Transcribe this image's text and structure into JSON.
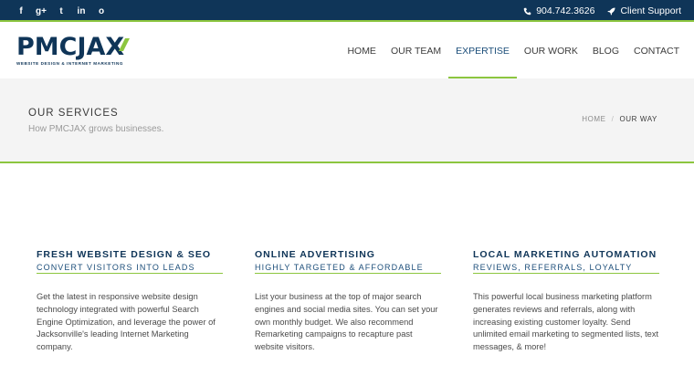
{
  "social": {
    "icons": [
      "facebook-icon",
      "google-plus-icon",
      "twitter-icon",
      "linkedin-icon",
      "instagram-icon"
    ],
    "glyphs": [
      "f",
      "g+",
      "t",
      "in",
      "o"
    ]
  },
  "topbar": {
    "phone": "904.742.3626",
    "support": "Client Support"
  },
  "logo": {
    "wordmark": "PMCJAX",
    "tagline": "WEBSITE DESIGN & INTERNET MARKETING"
  },
  "nav": {
    "items": [
      "HOME",
      "OUR TEAM",
      "EXPERTISE",
      "OUR WORK",
      "BLOG",
      "CONTACT"
    ],
    "active": "EXPERTISE"
  },
  "banner": {
    "title": "OUR SERVICES",
    "subtitle": "How PMCJAX grows businesses.",
    "breadcrumb_home": "HOME",
    "breadcrumb_sep": "/",
    "breadcrumb_current": "OUR WAY"
  },
  "services": [
    {
      "heading": "FRESH WEBSITE DESIGN & SEO",
      "subheading": "CONVERT VISITORS INTO LEADS",
      "body": "Get the latest in responsive website design technology integrated with powerful Search Engine Optimization, and leverage the power of Jacksonville's leading Internet Marketing company."
    },
    {
      "heading": "ONLINE ADVERTISING",
      "subheading": "HIGHLY TARGETED & AFFORDABLE",
      "body": "List your business at the top of major search engines and social media sites. You can set your own monthly budget. We also recommend Remarketing campaigns to recapture past website visitors."
    },
    {
      "heading": "LOCAL MARKETING AUTOMATION",
      "subheading": "REVIEWS, REFERRALS, LOYALTY",
      "body": "This powerful local business marketing platform generates reviews and referrals, along with increasing existing customer loyalty. Send unlimited email marketing to segmented lists, text messages, & more!"
    }
  ],
  "colors": {
    "navy": "#0f3558",
    "accent_green": "#8cc63f",
    "banner_bg": "#f4f4f4"
  }
}
